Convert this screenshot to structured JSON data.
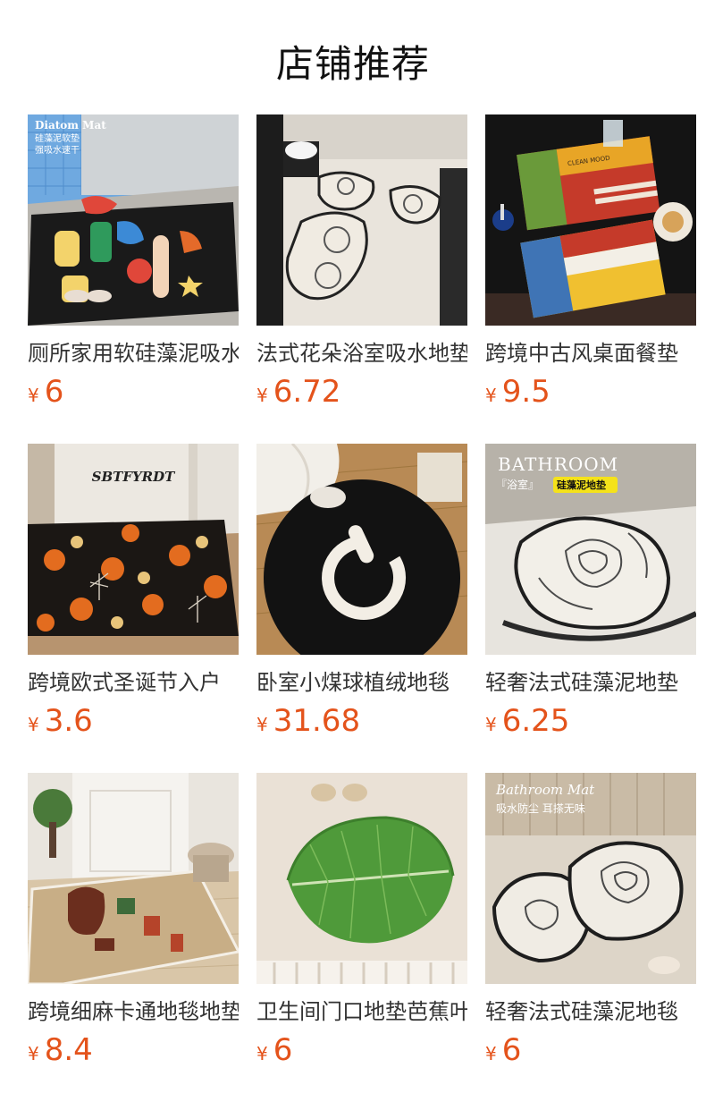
{
  "page_title": "店铺推荐",
  "currency": "¥",
  "products": [
    {
      "name": "厕所家用软硅藻泥吸水地垫",
      "price": "6",
      "image_text": [
        "Diatom Mat",
        "硅藻泥软垫",
        "强吸水速干"
      ]
    },
    {
      "name": "法式花朵浴室吸水地垫",
      "price": "6.72",
      "image_text": []
    },
    {
      "name": "跨境中古风桌面餐垫",
      "price": "9.5",
      "image_text": [
        "CLEAN MOOD"
      ]
    },
    {
      "name": "跨境欧式圣诞节入户",
      "price": "3.6",
      "image_text": [
        "SBTFYRDT"
      ]
    },
    {
      "name": "卧室小煤球植绒地毯",
      "price": "31.68",
      "image_text": []
    },
    {
      "name": "轻奢法式硅藻泥地垫",
      "price": "6.25",
      "image_text": [
        "BATHROOM",
        "『浴室』",
        "硅藻泥地垫"
      ]
    },
    {
      "name": "跨境细麻卡通地毯地垫",
      "price": "8.4",
      "image_text": []
    },
    {
      "name": "卫生间门口地垫芭蕉叶",
      "price": "6",
      "image_text": []
    },
    {
      "name": "轻奢法式硅藻泥地毯",
      "price": "6",
      "image_text": [
        "Bathroom Mat",
        "吸水防尘 耳搽无味"
      ]
    }
  ]
}
